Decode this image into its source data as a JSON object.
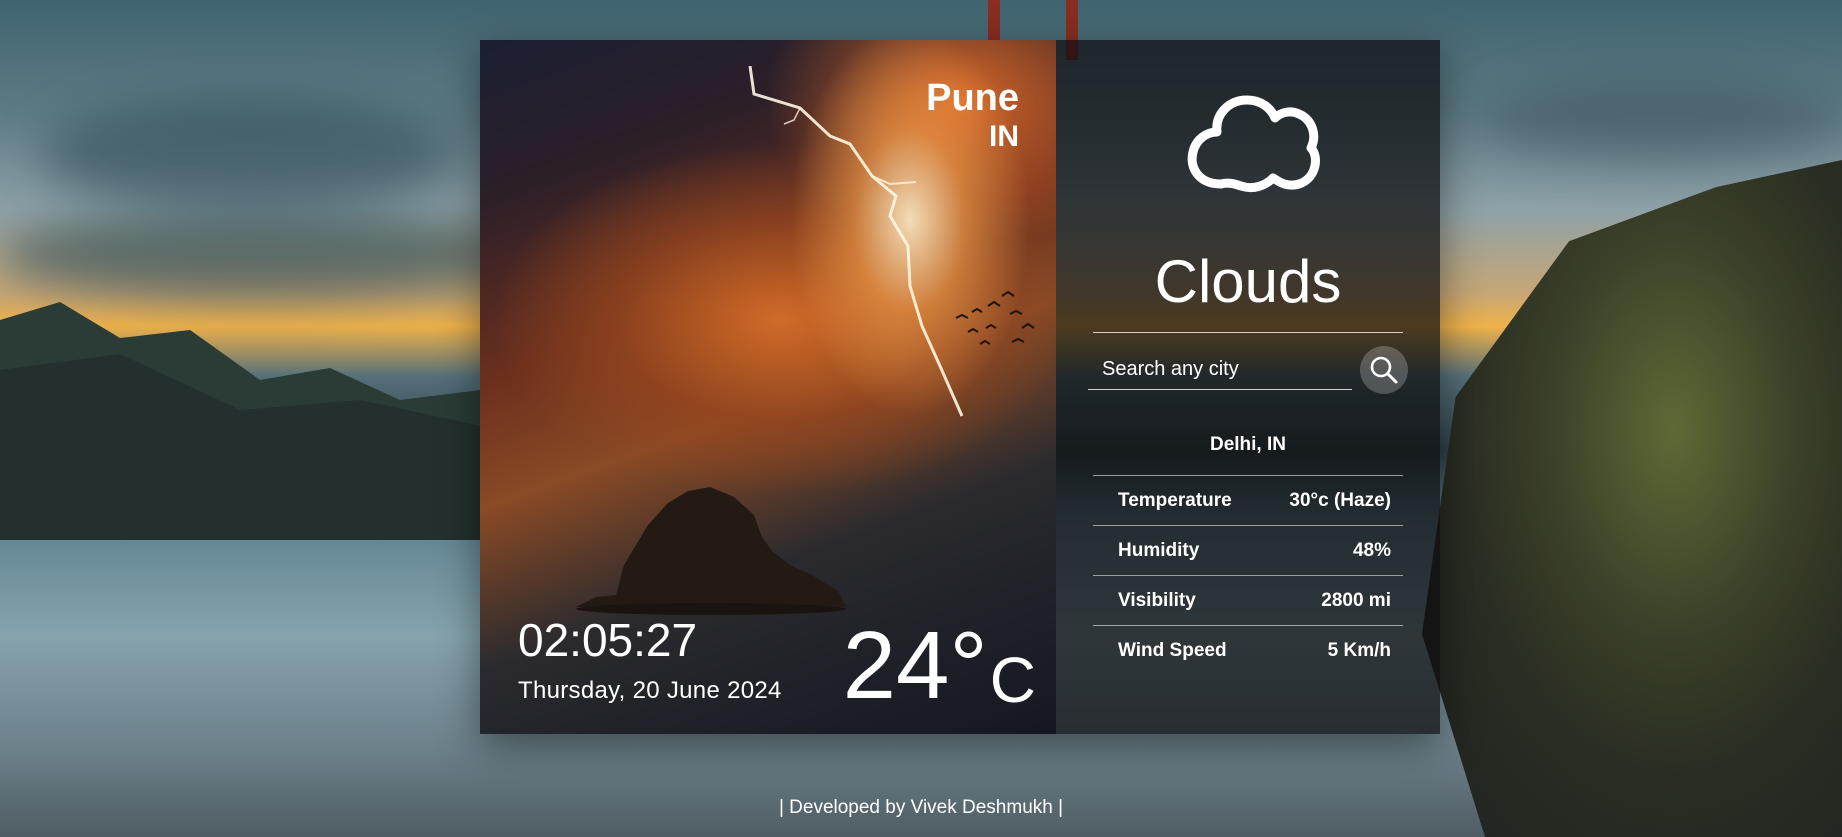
{
  "location": {
    "city": "Pune",
    "country": "IN"
  },
  "clock": {
    "time": "02:05:27",
    "date": "Thursday, 20 June 2024"
  },
  "current_temp": {
    "value": "24°",
    "unit": "C"
  },
  "weather": {
    "icon": "cloud-icon",
    "condition": "Clouds"
  },
  "search": {
    "placeholder": "Search any city",
    "button_icon": "search-icon"
  },
  "result": {
    "city": "Delhi, IN",
    "stats": [
      {
        "label": "Temperature",
        "value": "30°c (Haze)"
      },
      {
        "label": "Humidity",
        "value": "48%"
      },
      {
        "label": "Visibility",
        "value": "2800 mi"
      },
      {
        "label": "Wind Speed",
        "value": "5 Km/h"
      }
    ]
  },
  "footer": {
    "text": "| Developed by Vivek Deshmukh |"
  },
  "colors": {
    "panel_overlay": "#0c0c0e",
    "text": "#ffffff",
    "sky_glow": "#f0b24a"
  }
}
